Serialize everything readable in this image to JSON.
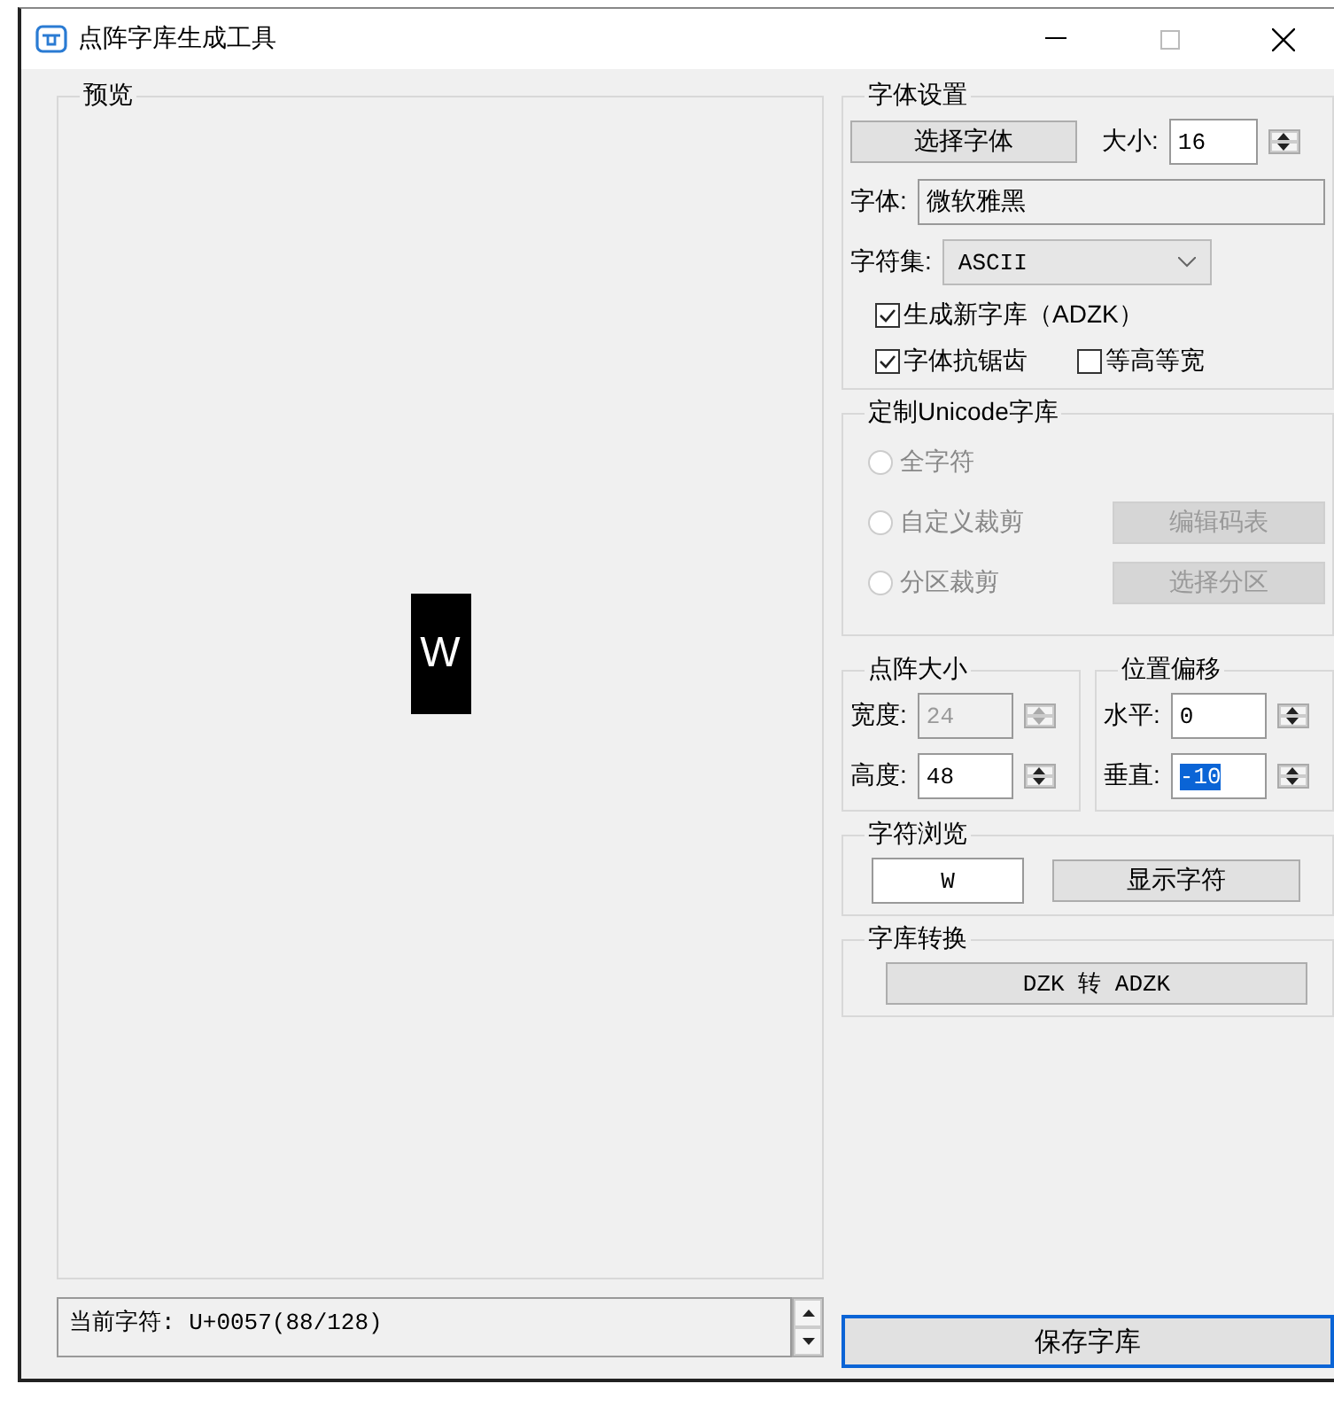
{
  "window": {
    "title": "点阵字库生成工具"
  },
  "preview": {
    "title": "预览",
    "glyph": "W"
  },
  "status": {
    "text": "当前字符: U+0057(88/128)"
  },
  "font_settings": {
    "title": "字体设置",
    "choose_button": "选择字体",
    "size_label": "大小:",
    "size_value": "16",
    "font_label": "字体:",
    "font_value": "微软雅黑",
    "charset_label": "字符集:",
    "charset_value": "ASCII",
    "options": [
      {
        "label": "生成新字库（ADZK）",
        "checked": true
      },
      {
        "label": "字体抗锯齿",
        "checked": true
      },
      {
        "label": "等高等宽",
        "checked": false
      }
    ]
  },
  "unicode": {
    "title": "定制Unicode字库",
    "options": [
      {
        "label": "全字符",
        "selected": false,
        "disabled": true
      },
      {
        "label": "自定义裁剪",
        "selected": false,
        "disabled": true,
        "button": "编辑码表"
      },
      {
        "label": "分区裁剪",
        "selected": false,
        "disabled": true,
        "button": "选择分区"
      }
    ]
  },
  "dot_size": {
    "title": "点阵大小",
    "fields": [
      {
        "label": "宽度:",
        "value": "24",
        "disabled": true,
        "highlighted": false
      },
      {
        "label": "高度:",
        "value": "48",
        "disabled": false,
        "highlighted": false
      }
    ]
  },
  "offset": {
    "title": "位置偏移",
    "fields": [
      {
        "label": "水平:",
        "value": "0",
        "disabled": false,
        "highlighted": false
      },
      {
        "label": "垂直:",
        "value": "-10",
        "disabled": false,
        "highlighted": true
      }
    ]
  },
  "char_browse": {
    "title": "字符浏览",
    "value": "W",
    "button": "显示字符"
  },
  "convert": {
    "title": "字库转换",
    "button": "DZK 转 ADZK"
  },
  "save_button": "保存字库"
}
